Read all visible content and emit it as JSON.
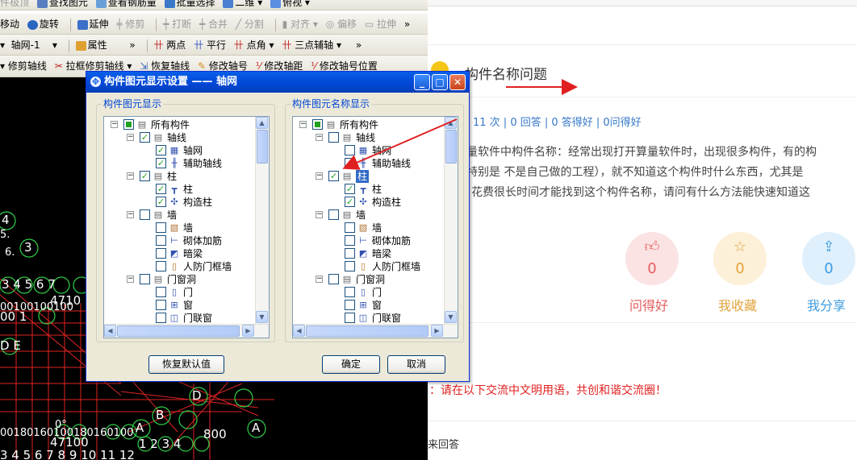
{
  "colors": {
    "accent": "#0046d5",
    "red": "#e02020",
    "link": "#3478c8",
    "good": "#e45b5b",
    "fav": "#e0a33c",
    "share": "#3d9be0"
  },
  "toolbar1": {
    "items": [
      "件极顶",
      "查找图元",
      "查看钢筋量",
      "批量选择",
      "二维",
      "俯视"
    ]
  },
  "toolbar2": {
    "items": [
      "移动",
      "旋转",
      "延伸",
      "修剪",
      "打断",
      "合并",
      "分割",
      "对齐",
      "偏移",
      "拉伸"
    ]
  },
  "toolbar3": {
    "axis_select": "轴网-1",
    "properties": "属性",
    "items": [
      "两点",
      "平行",
      "点角",
      "三点辅轴"
    ]
  },
  "toolbar4": {
    "items": [
      "修剪轴线",
      "拉框修剪轴线",
      "恢复轴线",
      "修改轴号",
      "修改轴距",
      "修改轴号位置"
    ]
  },
  "cad_labels": {
    "a": "4",
    "b": "3",
    "c": "3 4 5  6  7",
    "d": "00100100100",
    "e": "4710",
    "f": "00  1",
    "g": "D E",
    "h": "D",
    "i": "B",
    "j": "A",
    "k": "A",
    "l": "0°",
    "m": "00180160100180160100",
    "n": "47100",
    "o": "800",
    "p": "1  2  3  4",
    "q": "3 4 5 6 7 8 9 10 11 12",
    "r": "5.",
    "s": "6."
  },
  "dialog": {
    "title": "构件图元显示设置 —— 轴网",
    "left_group": "构件图元显示",
    "right_group": "构件图元名称显示",
    "reset": "恢复默认值",
    "ok": "确定",
    "cancel": "取消",
    "tree_labels": [
      "所有构件",
      "轴线",
      "轴网",
      "辅助轴线",
      "柱",
      "柱",
      "构造柱",
      "墙",
      "墙",
      "砌体加筋",
      "暗梁",
      "人防门框墙",
      "门窗洞",
      "门",
      "窗",
      "门联窗"
    ]
  },
  "web": {
    "question_title": "构件名称问题",
    "stats": "11 次 | 0 回答 | 0 答得好 | 0问得好",
    "body_line1": "量软件中构件名称：经常出现打开算量软件时，出现很多构件，有的构",
    "body_line2": "特别是  不是自己做的工程），就不知道这个构件时什么东西，尤其是",
    "body_line3": "花费很长时间才能找到这个构件名称，请问有什么方法能快速知道这",
    "good_count": "0",
    "good_label": "问得好",
    "fav_count": "0",
    "fav_label": "我收藏",
    "share_count": "0",
    "share_label": "我分享",
    "notice": "：请在以下交流中文明用语，共创和谐交流圈！",
    "answer_label": "来回答"
  }
}
